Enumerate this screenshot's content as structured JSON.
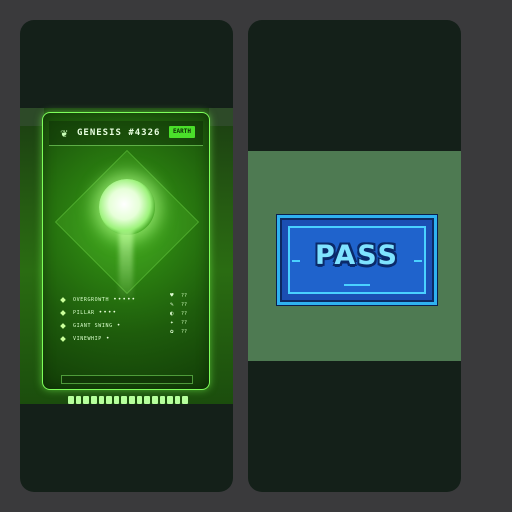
{
  "left_card": {
    "title": "GENESIS #4326",
    "element": "EARTH",
    "traits": [
      {
        "name": "OVERGROWTH",
        "dots": "•••••"
      },
      {
        "name": "PILLAR",
        "dots": "••••"
      },
      {
        "name": "GIANT SWING",
        "dots": "•"
      },
      {
        "name": "VINEWHIP",
        "dots": "•"
      }
    ],
    "stats": [
      {
        "icon": "♥",
        "value": "??"
      },
      {
        "icon": "✎",
        "value": "??"
      },
      {
        "icon": "◐",
        "value": "??"
      },
      {
        "icon": "✦",
        "value": "??"
      },
      {
        "icon": "✿",
        "value": "??"
      }
    ]
  },
  "right_pass": {
    "label": "PASS"
  },
  "colors": {
    "page_bg": "#3a3a3c",
    "panel_bg": "#142019",
    "card_green": "#2a7d10",
    "pass_blue": "#1b4fb3",
    "pass_text": "#7fe3ff"
  },
  "icons": {
    "gem": "leaf-gem-icon"
  }
}
